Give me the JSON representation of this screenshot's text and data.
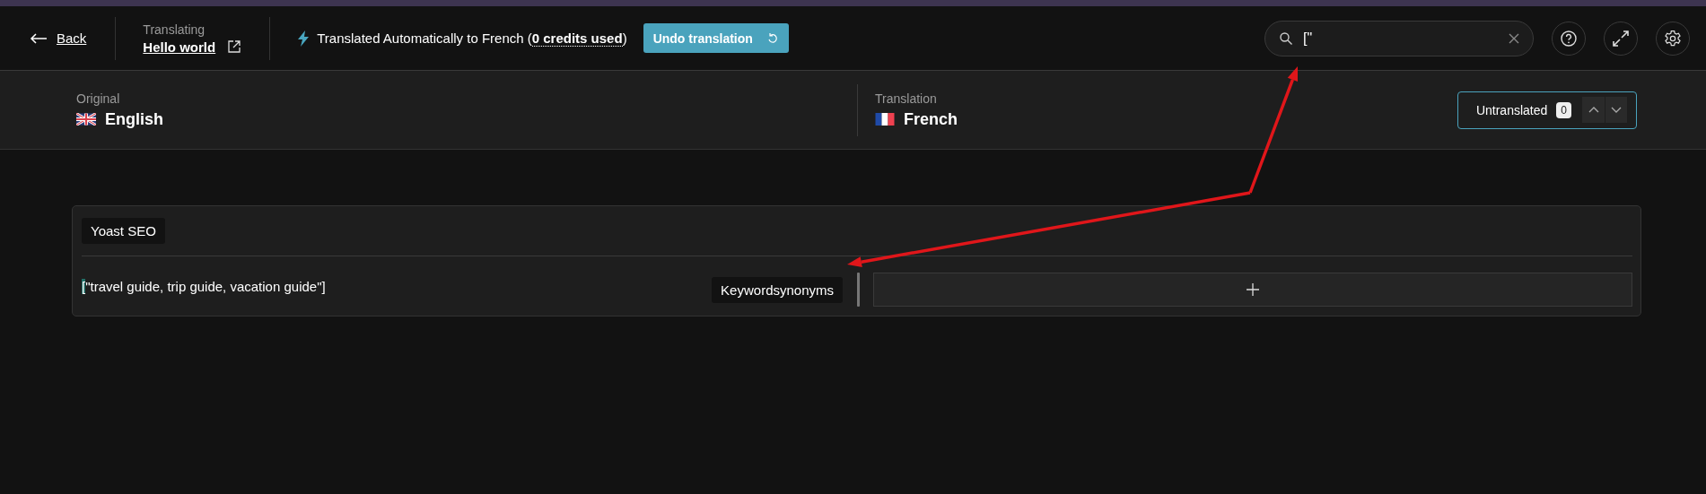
{
  "back": {
    "label": "Back"
  },
  "document": {
    "caption": "Translating",
    "title": "Hello world"
  },
  "status": {
    "text": "Translated Automatically to French (**0 credits used**)"
  },
  "undo_button": {
    "label": "Undo translation"
  },
  "search": {
    "value": "[\""
  },
  "languages": [
    {
      "caption": "Original",
      "name": "English",
      "kind": "uk"
    },
    {
      "caption": "Translation",
      "name": "French",
      "kind": "fr"
    }
  ],
  "untranslated": {
    "label": "Untranslated",
    "count": "0"
  },
  "groups": [
    {
      "title": "Yoast SEO",
      "fields": [
        {
          "source_match": "[",
          "source_rest": "\"travel guide, trip guide, vacation guide\"]",
          "label": "Keywordsynonyms"
        }
      ]
    }
  ],
  "annotations": [
    {
      "kind": "arrow"
    },
    {
      "kind": "arrow"
    }
  ]
}
